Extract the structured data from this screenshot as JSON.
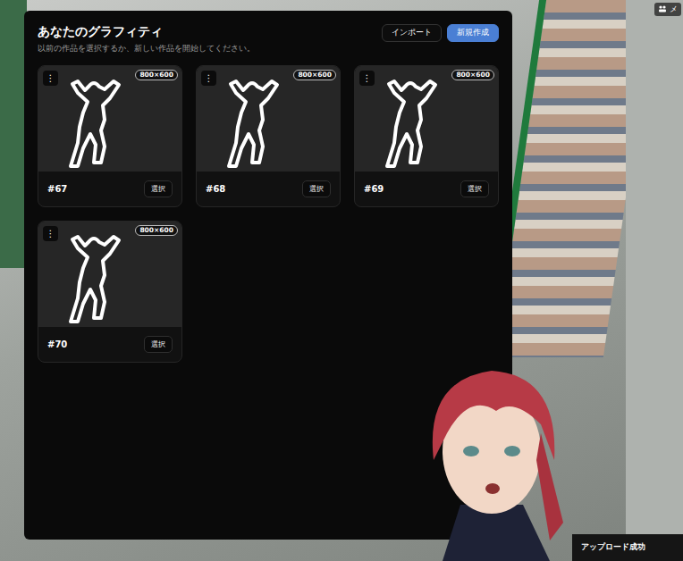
{
  "panel": {
    "title": "あなたのグラフィティ",
    "subtitle": "以前の作品を選択するか、新しい作品を開始してください。",
    "buttons": [
      {
        "label": "インポート",
        "kind": "secondary"
      },
      {
        "label": "新規作成",
        "kind": "primary"
      }
    ]
  },
  "graffiti": [
    {
      "name": "#67",
      "size": "800×600",
      "menu": "⋮",
      "action": "選択"
    },
    {
      "name": "#68",
      "size": "800×600",
      "menu": "⋮",
      "action": "選択"
    },
    {
      "name": "#69",
      "size": "800×600",
      "menu": "⋮",
      "action": "選択"
    },
    {
      "name": "#70",
      "size": "800×600",
      "menu": "⋮",
      "action": "選択"
    }
  ],
  "hud": {
    "label": "メ"
  },
  "toast": {
    "text": "アップロード成功"
  }
}
